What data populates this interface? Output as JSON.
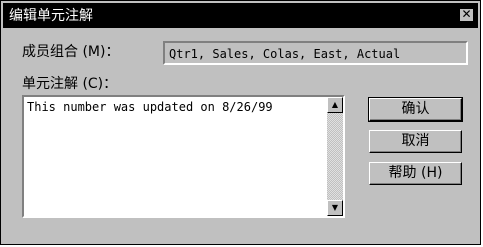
{
  "window": {
    "title": "编辑单元注解"
  },
  "member_combo": {
    "label": "成员组合 (M)：",
    "value": "Qtr1, Sales, Colas, East, Actual"
  },
  "cell_note": {
    "label": "单元注解 (C)：",
    "text": "This number was updated on 8/26/99"
  },
  "buttons": {
    "ok": "确认",
    "cancel": "取消",
    "help": "帮助 (H)"
  },
  "icons": {
    "close": "close-icon",
    "scroll_up": "up-arrow-icon",
    "scroll_down": "down-arrow-icon"
  }
}
